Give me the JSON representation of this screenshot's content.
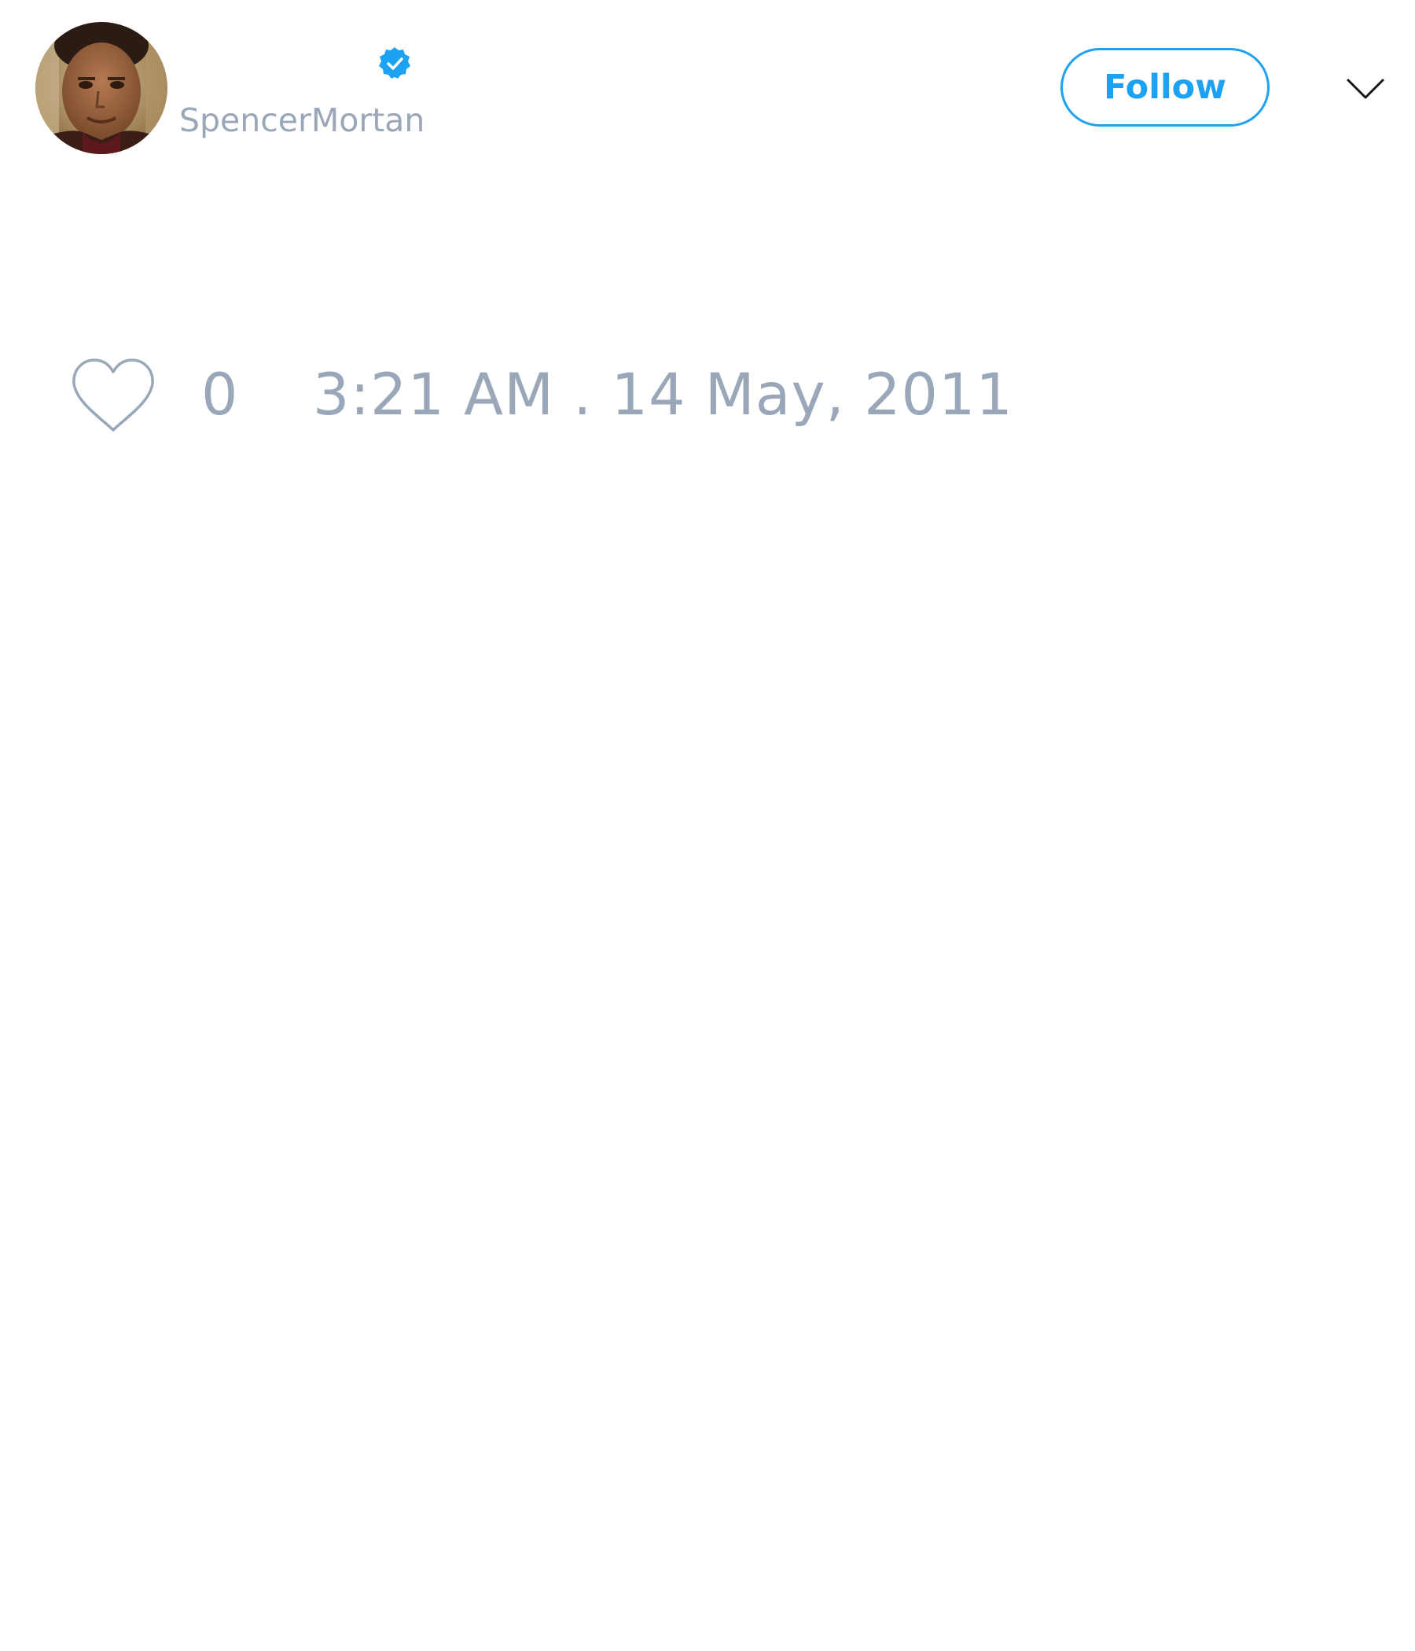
{
  "user": {
    "handle": "SpencerMortan",
    "verified": true,
    "avatar_icon": "profile-photo"
  },
  "actions": {
    "follow_label": "Follow",
    "menu_icon": "chevron-down-icon"
  },
  "tweet": {
    "like_icon": "heart-outline-icon",
    "like_count": "0",
    "timestamp": "3:21 AM . 14 May, 2011"
  },
  "colors": {
    "accent": "#1da1f2",
    "muted_text": "#9aa7b8",
    "background": "#ffffff"
  }
}
